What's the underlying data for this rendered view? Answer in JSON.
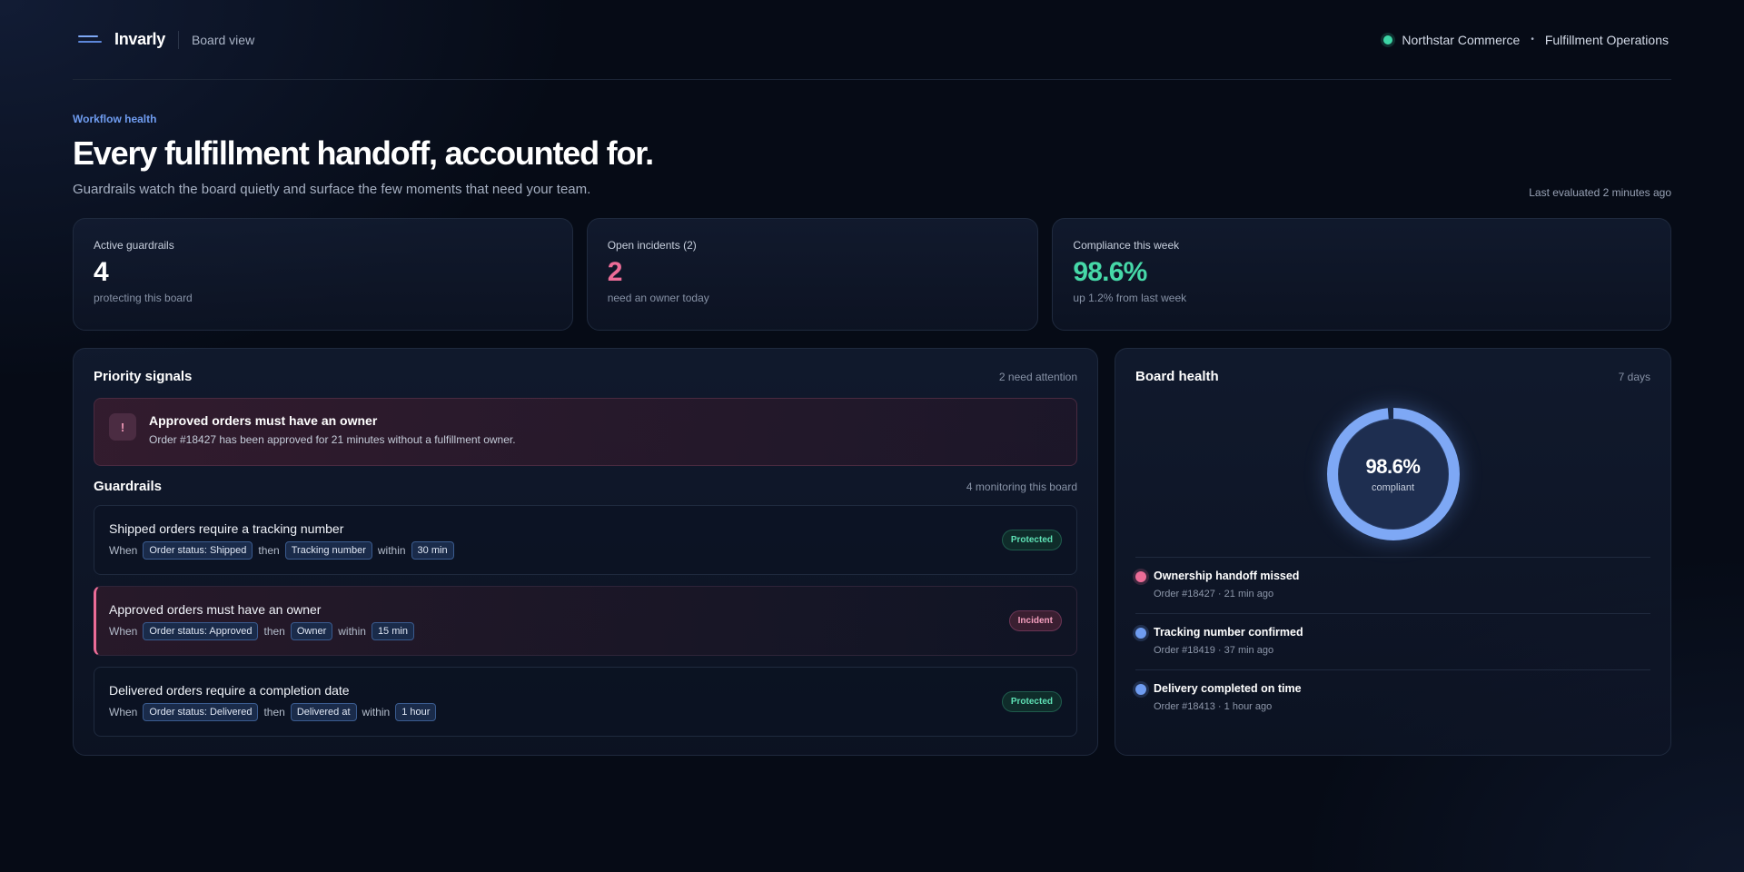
{
  "colors": {
    "accent": "#7ea8f5",
    "danger": "#ec6c97",
    "success": "#3dd6a6"
  },
  "header": {
    "brand": "Invarly",
    "view": "Board view",
    "org": "Northstar Commerce",
    "separator": "•",
    "team": "Fulfillment Operations",
    "icons": [
      "menu-logo-icon",
      "status-dot-icon"
    ]
  },
  "hero": {
    "eyebrow": "Workflow health",
    "title": "Every fulfillment handoff, accounted for.",
    "subtitle": "Guardrails watch the board quietly and surface the few moments that need your team.",
    "last_evaluated": "Last evaluated 2 minutes ago"
  },
  "stats": [
    {
      "label": "Active guardrails",
      "value": "4",
      "sub": "protecting this board",
      "color": "#ffffff"
    },
    {
      "label": "Open incidents (2)",
      "value": "2",
      "sub": "need an owner today",
      "color": "#ec6c97"
    },
    {
      "label": "Compliance this week",
      "value": "98.6%",
      "sub": "up 1.2% from last week",
      "color": "#46d8a8"
    }
  ],
  "priority": {
    "title": "Priority signals",
    "meta": "2 need attention",
    "alert": {
      "icon": "!",
      "title": "Approved orders must have an owner",
      "text": "Order #18427 has been approved for 21 minutes without a fulfillment owner."
    }
  },
  "guardrails": {
    "title": "Guardrails",
    "meta": "4 monitoring this board",
    "when": "When",
    "then": "then",
    "within": "within",
    "rules": [
      {
        "title": "Shipped orders require a tracking number",
        "condition": "Order status: Shipped",
        "target": "Tracking number",
        "window": "30 min",
        "status": "Protected"
      },
      {
        "title": "Approved orders must have an owner",
        "condition": "Order status: Approved",
        "target": "Owner",
        "window": "15 min",
        "status": "Incident"
      },
      {
        "title": "Delivered orders require a completion date",
        "condition": "Order status: Delivered",
        "target": "Delivered at",
        "window": "1 hour",
        "status": "Protected"
      }
    ]
  },
  "board_health": {
    "title": "Board health",
    "meta": "7 days",
    "compliance": 98.6,
    "value_label": "98.6%",
    "caption": "compliant",
    "events": [
      {
        "title": "Ownership handoff missed",
        "sub": "Order #18427 · 21 min ago",
        "dot": "#ec6c97"
      },
      {
        "title": "Tracking number confirmed",
        "sub": "Order #18419 · 37 min ago",
        "dot": "#6f9cf0"
      },
      {
        "title": "Delivery completed on time",
        "sub": "Order #18413 · 1 hour ago",
        "dot": "#6f9cf0"
      }
    ]
  }
}
